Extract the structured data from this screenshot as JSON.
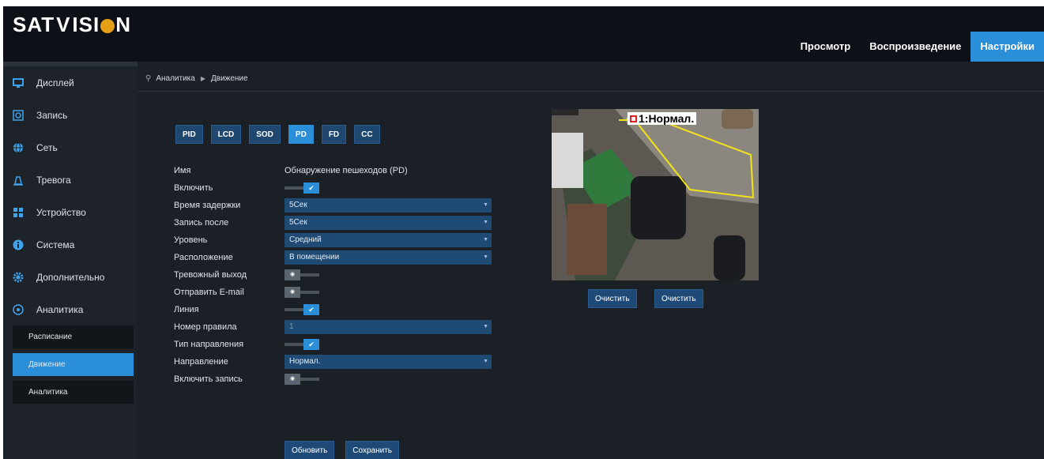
{
  "header": {
    "logo_text": "SAT VISION",
    "nav": [
      {
        "label": "Просмотр",
        "active": false
      },
      {
        "label": "Воспроизведение",
        "active": false
      },
      {
        "label": "Настройки",
        "active": true
      }
    ]
  },
  "sidebar": {
    "items": [
      {
        "label": "Дисплей",
        "icon": "monitor-icon"
      },
      {
        "label": "Запись",
        "icon": "record-icon"
      },
      {
        "label": "Сеть",
        "icon": "globe-icon"
      },
      {
        "label": "Тревога",
        "icon": "alarm-icon"
      },
      {
        "label": "Устройство",
        "icon": "device-icon"
      },
      {
        "label": "Система",
        "icon": "info-icon"
      },
      {
        "label": "Дополнительно",
        "icon": "gear-icon"
      },
      {
        "label": "Аналитика",
        "icon": "analytics-icon"
      }
    ],
    "sub_items": [
      {
        "label": "Расписание",
        "active": false
      },
      {
        "label": "Движение",
        "active": true
      },
      {
        "label": "Аналитика",
        "active": false
      }
    ]
  },
  "breadcrumb": {
    "section": "Аналитика",
    "page": "Движение"
  },
  "tabs": [
    {
      "label": "PID",
      "active": false
    },
    {
      "label": "LCD",
      "active": false
    },
    {
      "label": "SOD",
      "active": false
    },
    {
      "label": "PD",
      "active": true
    },
    {
      "label": "FD",
      "active": false
    },
    {
      "label": "CC",
      "active": false
    }
  ],
  "form": {
    "name_label": "Имя",
    "name_value": "Обнаружение пешеходов (PD)",
    "enable_label": "Включить",
    "enable_on": true,
    "delay_label": "Время задержки",
    "delay_value": "5Сек",
    "record_after_label": "Запись после",
    "record_after_value": "5Сек",
    "level_label": "Уровень",
    "level_value": "Средний",
    "location_label": "Расположение",
    "location_value": "В помещении",
    "alarm_out_label": "Тревожный выход",
    "alarm_out_on": false,
    "email_label": "Отправить E-mail",
    "email_on": false,
    "line_label": "Линия",
    "line_on": true,
    "rule_label": "Номер правила",
    "rule_value": "1",
    "dir_type_label": "Тип направления",
    "dir_type_on": true,
    "direction_label": "Направление",
    "direction_value": "Нормал.",
    "enable_record_label": "Включить запись",
    "enable_record_on": false
  },
  "preview": {
    "osd_text": "1:Нормал.",
    "clear_label_1": "Очистить",
    "clear_label_2": "Очистить"
  },
  "actions": {
    "refresh_label": "Обновить",
    "save_label": "Сохранить"
  },
  "colors": {
    "accent": "#2a8fd8",
    "select_bg": "#1e4a74",
    "detection_line": "#f2e21a"
  }
}
